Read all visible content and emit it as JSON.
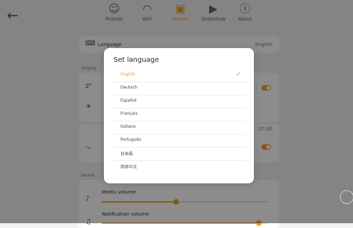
{
  "nav": {
    "back_icon": "arrow-left-icon",
    "items": [
      {
        "label": "Friends",
        "icon": "friends-icon",
        "glyph": "☺"
      },
      {
        "label": "WiFi",
        "icon": "wifi-icon",
        "glyph": "◠"
      },
      {
        "label": "Frame",
        "icon": "frame-icon",
        "glyph": "▣",
        "active": true
      },
      {
        "label": "Slideshow",
        "icon": "slideshow-icon",
        "glyph": "▶"
      },
      {
        "label": "About",
        "icon": "info-icon",
        "glyph": "ⓘ"
      }
    ]
  },
  "settings": {
    "language_label": "Language",
    "language_value": "English",
    "display_section": "Display",
    "sleep_value": "07:00",
    "sound_section": "Sound",
    "media_volume_label": "Media volume",
    "media_volume_level": 0.45,
    "notification_volume_label": "Notification volume",
    "notification_volume_level": 0.95
  },
  "dialog": {
    "title": "Set language",
    "selected": "English",
    "options": [
      "English",
      "Deutsch",
      "Español",
      "Français",
      "Italiano",
      "Português",
      "日本語",
      "简体中文"
    ]
  },
  "colors": {
    "accent": "#f0a020",
    "background": "#f1f1f2",
    "overlay": "rgba(0,0,0,0.45)"
  }
}
